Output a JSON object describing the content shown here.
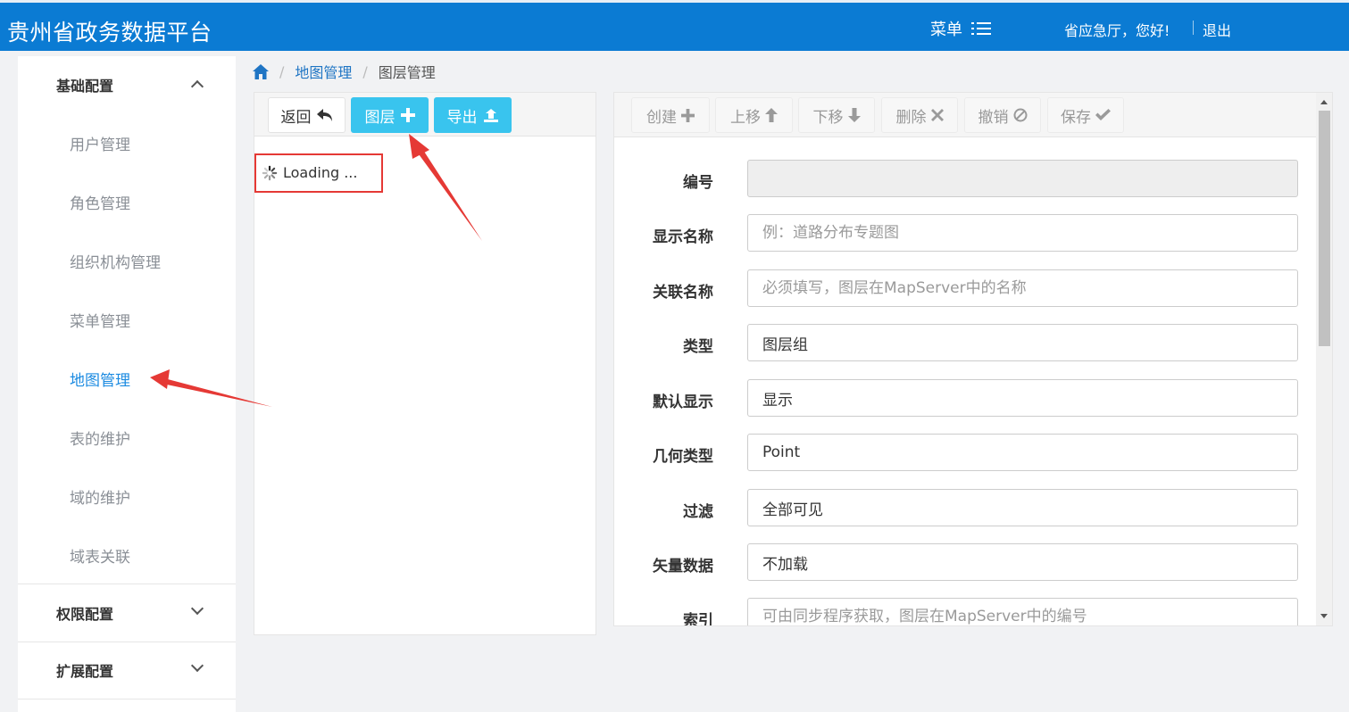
{
  "header": {
    "app_title": "贵州省政务数据平台",
    "menu_label": "菜单",
    "greeting": "省应急厅，您好!",
    "logout_label": "退出"
  },
  "sidebar": {
    "groups": [
      {
        "label": "基础配置",
        "expanded": true
      },
      {
        "label": "权限配置",
        "expanded": false
      },
      {
        "label": "扩展配置",
        "expanded": false
      }
    ],
    "items": [
      {
        "label": "用户管理"
      },
      {
        "label": "角色管理"
      },
      {
        "label": "组织机构管理"
      },
      {
        "label": "菜单管理"
      },
      {
        "label": "地图管理",
        "active": true
      },
      {
        "label": "表的维护"
      },
      {
        "label": "域的维护"
      },
      {
        "label": "域表关联"
      }
    ]
  },
  "breadcrumb": {
    "home_icon": "home-icon",
    "items": [
      "地图管理",
      "图层管理"
    ]
  },
  "left_toolbar": {
    "back_label": "返回",
    "layer_label": "图层",
    "export_label": "导出"
  },
  "tree": {
    "loading_text": "Loading ..."
  },
  "right_toolbar": {
    "create_label": "创建",
    "move_up_label": "上移",
    "move_down_label": "下移",
    "delete_label": "删除",
    "undo_label": "撤销",
    "save_label": "保存"
  },
  "form": {
    "fields": [
      {
        "label": "编号",
        "value": "",
        "placeholder": ""
      },
      {
        "label": "显示名称",
        "value": "",
        "placeholder": "例：道路分布专题图"
      },
      {
        "label": "关联名称",
        "value": "",
        "placeholder": "必须填写，图层在MapServer中的名称"
      },
      {
        "label": "类型",
        "value": "图层组",
        "placeholder": ""
      },
      {
        "label": "默认显示",
        "value": "显示",
        "placeholder": ""
      },
      {
        "label": "几何类型",
        "value": "Point",
        "placeholder": ""
      },
      {
        "label": "过滤",
        "value": "全部可见",
        "placeholder": ""
      },
      {
        "label": "矢量数据",
        "value": "不加载",
        "placeholder": ""
      },
      {
        "label": "索引",
        "value": "",
        "placeholder": "可由同步程序获取，图层在MapServer中的编号"
      }
    ]
  },
  "colors": {
    "header_bg": "#0b7bd3",
    "accent_cyan": "#39c4ee",
    "active_link": "#1c8be1",
    "annotation_red": "#e53935"
  }
}
